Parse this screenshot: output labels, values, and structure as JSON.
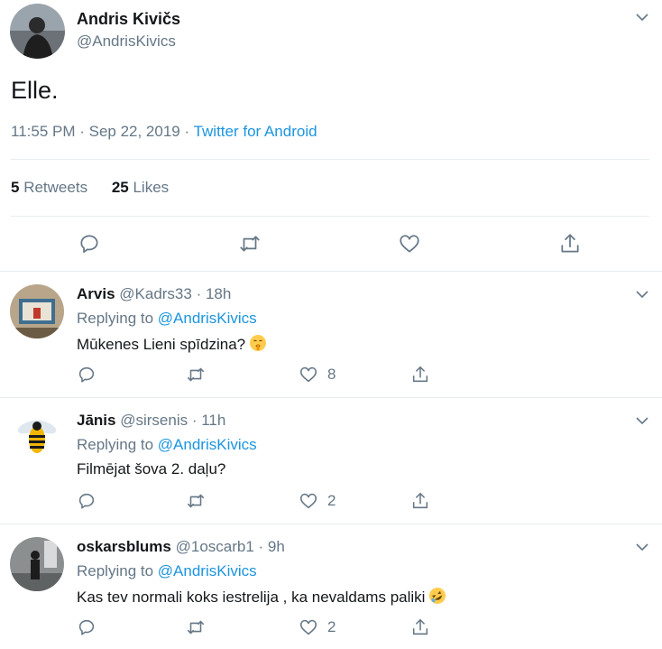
{
  "tweet": {
    "author_name": "Andris Kivičs",
    "author_handle": "@AndrisKivics",
    "text": "Elle.",
    "time": "11:55 PM · Sep 22, 2019 · ",
    "source": "Twitter for Android",
    "retweets_count": "5",
    "retweets_label": "Retweets",
    "likes_count": "25",
    "likes_label": "Likes"
  },
  "replies": [
    {
      "name": "Arvis",
      "meta": "@Kadrs33 · 18h",
      "replying_label": "Replying to",
      "replying_to": "@AndrisKivics",
      "text": "Mūkenes Lieni spīdzina?",
      "emoji": "shushing-face",
      "likes": "8"
    },
    {
      "name": "Jānis",
      "meta": "@sirsenis · 11h",
      "replying_label": "Replying to",
      "replying_to": "@AndrisKivics",
      "text": "Filmējat šova 2. daļu?",
      "likes": "2"
    },
    {
      "name": "oskarsblums",
      "meta": "@1oscarb1 · 9h",
      "replying_label": "Replying to",
      "replying_to": "@AndrisKivics",
      "text": "Kas tev normali koks iestrelija , ka nevaldams paliki",
      "emoji": "rolling-on-floor-laughing",
      "likes": "2"
    }
  ],
  "colors": {
    "link": "#1b95e0",
    "secondary_text": "#657786",
    "divider": "#e6ecf0"
  }
}
